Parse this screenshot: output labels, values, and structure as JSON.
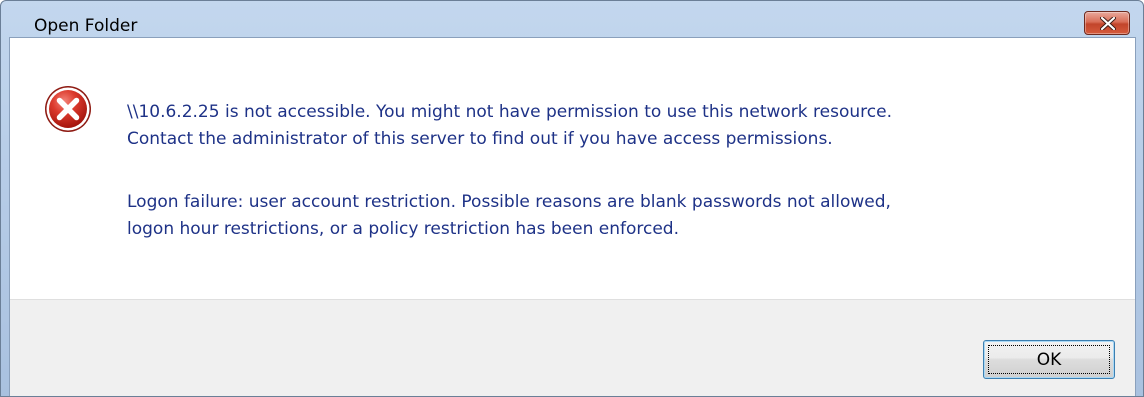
{
  "window": {
    "title": "Open Folder",
    "close_icon": "close-icon"
  },
  "dialog": {
    "icon": "error-icon",
    "message_primary": [
      "\\\\10.6.2.25 is not accessible. You might not have permission to use this network resource.",
      "Contact the administrator of this server to find out if you have access permissions."
    ],
    "message_secondary": [
      "Logon failure: user account restriction. Possible reasons are blank passwords not allowed,",
      "logon hour restrictions, or a policy restriction has been enforced."
    ]
  },
  "buttons": {
    "ok_label": "OK"
  },
  "colors": {
    "message_text": "#1e3287",
    "error_red": "#d8251b",
    "close_red": "#c2452b"
  }
}
